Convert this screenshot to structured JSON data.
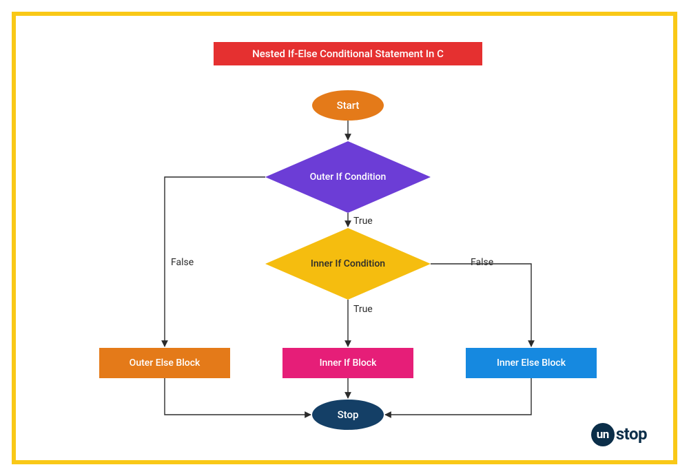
{
  "title": "Nested If-Else Conditional Statement In C",
  "nodes": {
    "start": "Start",
    "outer_if": "Outer If Condition",
    "inner_if": "Inner If Condition",
    "outer_else_block": "Outer Else Block",
    "inner_if_block": "Inner If Block",
    "inner_else_block": "Inner Else Block",
    "stop": "Stop"
  },
  "edges": {
    "outer_false": "False",
    "outer_true": "True",
    "inner_false": "False",
    "inner_true": "True"
  },
  "brand": {
    "circle": "un",
    "rest": "stop"
  },
  "chart_data": {
    "type": "flowchart",
    "title": "Nested If-Else Conditional Statement In C",
    "nodes": [
      {
        "id": "start",
        "kind": "terminator",
        "label": "Start"
      },
      {
        "id": "outer_cond",
        "kind": "decision",
        "label": "Outer If Condition"
      },
      {
        "id": "inner_cond",
        "kind": "decision",
        "label": "Inner If Condition"
      },
      {
        "id": "outer_else",
        "kind": "process",
        "label": "Outer Else Block"
      },
      {
        "id": "inner_if_blk",
        "kind": "process",
        "label": "Inner If Block"
      },
      {
        "id": "inner_else",
        "kind": "process",
        "label": "Inner Else Block"
      },
      {
        "id": "stop",
        "kind": "terminator",
        "label": "Stop"
      }
    ],
    "edges": [
      {
        "from": "start",
        "to": "outer_cond",
        "label": ""
      },
      {
        "from": "outer_cond",
        "to": "outer_else",
        "label": "False"
      },
      {
        "from": "outer_cond",
        "to": "inner_cond",
        "label": "True"
      },
      {
        "from": "inner_cond",
        "to": "inner_if_blk",
        "label": "True"
      },
      {
        "from": "inner_cond",
        "to": "inner_else",
        "label": "False"
      },
      {
        "from": "outer_else",
        "to": "stop",
        "label": ""
      },
      {
        "from": "inner_if_blk",
        "to": "stop",
        "label": ""
      },
      {
        "from": "inner_else",
        "to": "stop",
        "label": ""
      }
    ]
  }
}
